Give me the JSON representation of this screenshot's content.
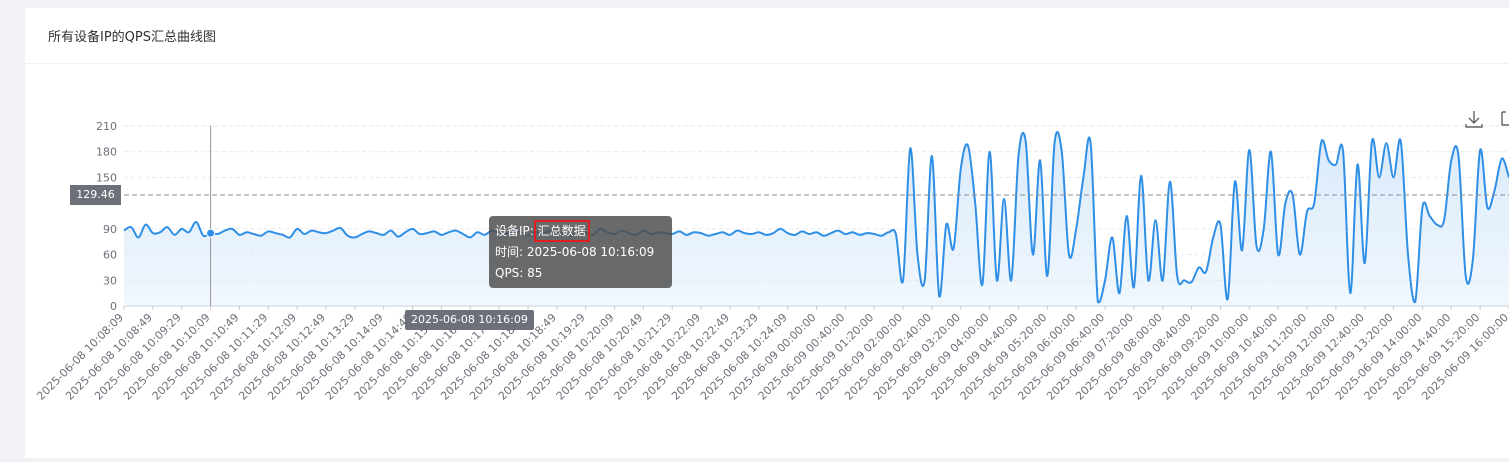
{
  "card": {
    "title": "所有设备IP的QPS汇总曲线图"
  },
  "toolbox": {
    "download_icon": "download-icon",
    "zoom_icon": "data-zoom-icon"
  },
  "tooltip": {
    "device_label": "设备IP: ",
    "device_value": "汇总数据",
    "time_line": "时间: 2025-06-08 10:16:09",
    "qps_line": "QPS: 85"
  },
  "axis_pointer": {
    "label": "2025-06-08 10:16:09",
    "index": 12
  },
  "mark_line": {
    "value": 129.46,
    "label": "129.46"
  },
  "colors": {
    "line": "#2f8fe6",
    "area": "#d7e9fb",
    "tooltip_bg": "#505050",
    "highlight": "#e02020"
  },
  "chart_data": {
    "type": "area",
    "title": "",
    "xlabel": "",
    "ylabel": "",
    "ylim": [
      0,
      210
    ],
    "yticks": [
      0,
      30,
      60,
      90,
      150,
      180,
      210
    ],
    "grid": true,
    "xtick_labels": [
      "2025-06-08 10:08:09",
      "2025-06-08 10:08:49",
      "2025-06-08 10:09:29",
      "2025-06-08 10:10:09",
      "2025-06-08 10:10:49",
      "2025-06-08 10:11:29",
      "2025-06-08 10:12:09",
      "2025-06-08 10:12:49",
      "2025-06-08 10:13:29",
      "2025-06-08 10:14:09",
      "2025-06-08 10:14:49",
      "2025-06-08 10:15:29",
      "2025-06-08 10:16:09",
      "2025-06-08 10:17:29",
      "2025-06-08 10:18:09",
      "2025-06-08 10:18:49",
      "2025-06-08 10:19:29",
      "2025-06-08 10:20:09",
      "2025-06-08 10:20:49",
      "2025-06-08 10:21:29",
      "2025-06-08 10:22:09",
      "2025-06-08 10:22:49",
      "2025-06-08 10:23:29",
      "2025-06-08 10:24:09",
      "2025-06-09 00:00:00",
      "2025-06-09 00:40:00",
      "2025-06-09 01:20:00",
      "2025-06-09 02:00:00",
      "2025-06-09 02:40:00",
      "2025-06-09 03:20:00",
      "2025-06-09 04:00:00",
      "2025-06-09 04:40:00",
      "2025-06-09 05:20:00",
      "2025-06-09 06:00:00",
      "2025-06-09 06:40:00",
      "2025-06-09 07:20:00",
      "2025-06-09 08:00:00",
      "2025-06-09 08:40:00",
      "2025-06-09 09:20:00",
      "2025-06-09 10:00:00",
      "2025-06-09 10:40:00",
      "2025-06-09 11:20:00",
      "2025-06-09 12:00:00",
      "2025-06-09 12:40:00",
      "2025-06-09 13:20:00",
      "2025-06-09 14:00:00",
      "2025-06-09 14:40:00",
      "2025-06-09 15:20:00",
      "2025-06-09 16:00:00"
    ],
    "series": [
      {
        "name": "汇总数据",
        "values": [
          88,
          92,
          80,
          95,
          85,
          86,
          92,
          83,
          90,
          86,
          98,
          82,
          85,
          84,
          88,
          90,
          83,
          86,
          84,
          82,
          87,
          85,
          83,
          80,
          90,
          84,
          88,
          86,
          85,
          88,
          91,
          82,
          80,
          84,
          87,
          85,
          83,
          88,
          81,
          86,
          90,
          84,
          85,
          87,
          83,
          86,
          88,
          84,
          80,
          86,
          83,
          88,
          85,
          84,
          90,
          86,
          82,
          86,
          84,
          88,
          86,
          84,
          82,
          87,
          85,
          83,
          90,
          86,
          84,
          88,
          85,
          83,
          88,
          84,
          86,
          85,
          84,
          87,
          83,
          86,
          85,
          82,
          84,
          86,
          83,
          88,
          85,
          84,
          86,
          83,
          85,
          90,
          85,
          83,
          87,
          84,
          86,
          82,
          85,
          88,
          84,
          86,
          83,
          85,
          84,
          82,
          86,
          84,
          30,
          184,
          60,
          30,
          175,
          12,
          95,
          67,
          160,
          187,
          120,
          25,
          180,
          30,
          125,
          30,
          175,
          192,
          60,
          170,
          35,
          190,
          180,
          60,
          90,
          150,
          190,
          5,
          30,
          80,
          15,
          105,
          22,
          152,
          30,
          100,
          30,
          145,
          35,
          30,
          28,
          45,
          40,
          80,
          95,
          8,
          145,
          65,
          182,
          70,
          90,
          180,
          60,
          120,
          130,
          60,
          110,
          120,
          192,
          170,
          165,
          180,
          15,
          165,
          50,
          192,
          150,
          190,
          150,
          192,
          60,
          5,
          115,
          105,
          95,
          100,
          170,
          175,
          35,
          55,
          182,
          115,
          135,
          172,
          150
        ]
      }
    ]
  }
}
